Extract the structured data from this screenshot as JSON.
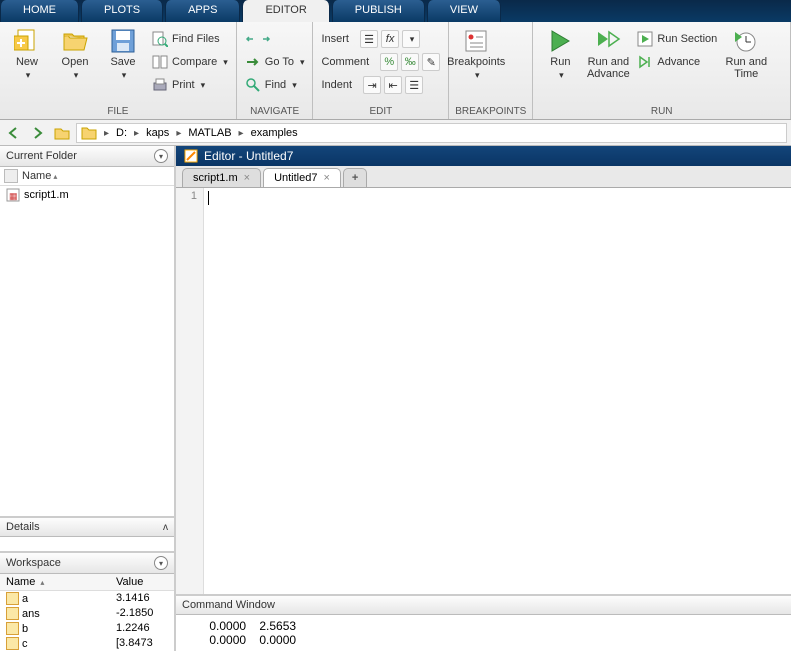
{
  "tabs": {
    "home": "HOME",
    "plots": "PLOTS",
    "apps": "APPS",
    "editor": "EDITOR",
    "publish": "PUBLISH",
    "view": "VIEW"
  },
  "ribbon": {
    "group_file": "FILE",
    "group_nav": "NAVIGATE",
    "group_edit": "EDIT",
    "group_break": "BREAKPOINTS",
    "group_run": "RUN",
    "new": "New",
    "open": "Open",
    "save": "Save",
    "find_files": "Find Files",
    "compare": "Compare",
    "print": "Print",
    "goto": "Go To",
    "find": "Find",
    "insert": "Insert",
    "comment": "Comment",
    "indent": "Indent",
    "breakpoints": "Breakpoints",
    "run": "Run",
    "run_adv": "Run and\nAdvance",
    "run_section": "Run Section",
    "advance": "Advance",
    "run_time": "Run and\nTime"
  },
  "path": {
    "drive": "D:",
    "p1": "kaps",
    "p2": "MATLAB",
    "p3": "examples"
  },
  "panes": {
    "current_folder": "Current Folder",
    "name_col": "Name",
    "file1": "script1.m",
    "details": "Details",
    "workspace": "Workspace",
    "ws_name": "Name",
    "ws_value": "Value",
    "rows": [
      {
        "n": "a",
        "v": "3.1416"
      },
      {
        "n": "ans",
        "v": "-2.1850"
      },
      {
        "n": "b",
        "v": "1.2246"
      },
      {
        "n": "c",
        "v": "[3.8473"
      }
    ]
  },
  "editor": {
    "title": "Editor - Untitled7",
    "tab1": "script1.m",
    "tab2": "Untitled7",
    "line1": "1"
  },
  "cmd": {
    "title": "Command Window",
    "out1": "    0.0000    2.5653",
    "out2": "    0.0000    0.0000"
  }
}
